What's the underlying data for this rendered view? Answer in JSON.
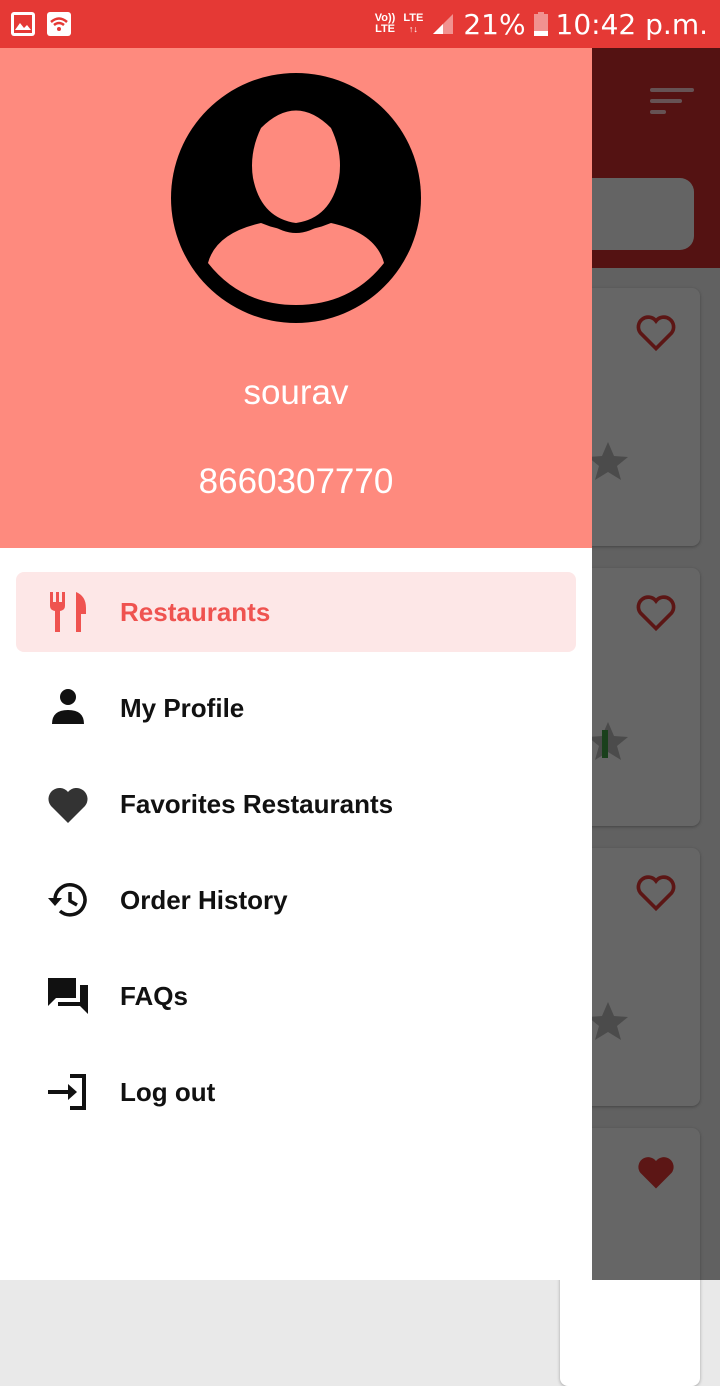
{
  "status_bar": {
    "volte_top": "Vo))",
    "volte_bottom": "LTE",
    "lte": "LTE",
    "battery": "21%",
    "time": "10:42 p.m."
  },
  "drawer": {
    "user_name": "sourav",
    "user_phone": "8660307770",
    "menu": [
      {
        "label": "Restaurants",
        "icon": "restaurant-icon",
        "active": true
      },
      {
        "label": "My Profile",
        "icon": "person-icon",
        "active": false
      },
      {
        "label": "Favorites Restaurants",
        "icon": "heart-icon",
        "active": false
      },
      {
        "label": "Order History",
        "icon": "history-icon",
        "active": false
      },
      {
        "label": "FAQs",
        "icon": "forum-icon",
        "active": false
      },
      {
        "label": "Log out",
        "icon": "logout-icon",
        "active": false
      }
    ]
  },
  "colors": {
    "status_bar": "#e53935",
    "header": "#fe8a7e",
    "accent": "#ef5350",
    "active_bg": "#fde7e7"
  }
}
